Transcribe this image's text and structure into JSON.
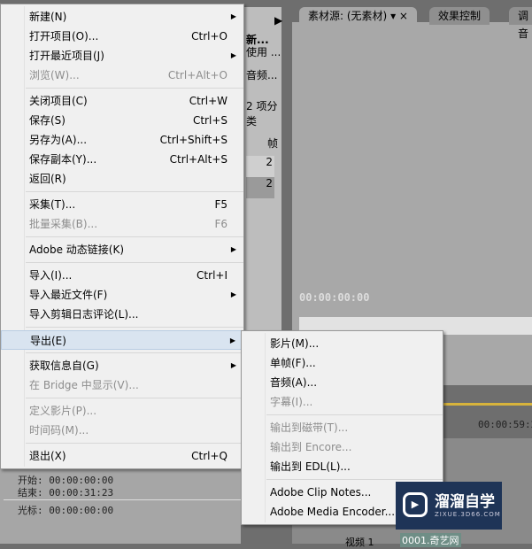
{
  "background": {
    "project_panel": {
      "line1": "新...",
      "line2": "使用 ...",
      "line3": "音频...",
      "count": "2 项分类",
      "col": "帧",
      "row1": "2",
      "row2": "2"
    },
    "source_tab": "素材源: (无素材)",
    "effects_tab": "效果控制",
    "mixer_tab": "调音",
    "source_timecode": "00:00:00:00",
    "timeline_timecode": "00:00:59:22",
    "info": {
      "start": "开始: 00:00:00:00",
      "end": "结束: 00:00:31:23",
      "cursor": "光标: 00:00:00:00"
    },
    "track_label": "视频 1",
    "clip_label": "0001.奇艺网"
  },
  "file_menu": [
    {
      "label": "新建(N)",
      "submenu": true
    },
    {
      "label": "打开项目(O)...",
      "shortcut": "Ctrl+O"
    },
    {
      "label": "打开最近项目(J)",
      "submenu": true
    },
    {
      "label": "浏览(W)...",
      "shortcut": "Ctrl+Alt+O",
      "disabled": true
    },
    {
      "sep": true
    },
    {
      "label": "关闭项目(C)",
      "shortcut": "Ctrl+W"
    },
    {
      "label": "保存(S)",
      "shortcut": "Ctrl+S"
    },
    {
      "label": "另存为(A)...",
      "shortcut": "Ctrl+Shift+S"
    },
    {
      "label": "保存副本(Y)...",
      "shortcut": "Ctrl+Alt+S"
    },
    {
      "label": "返回(R)"
    },
    {
      "sep": true
    },
    {
      "label": "采集(T)...",
      "shortcut": "F5"
    },
    {
      "label": "批量采集(B)...",
      "shortcut": "F6",
      "disabled": true
    },
    {
      "sep": true
    },
    {
      "label": "Adobe 动态链接(K)",
      "submenu": true
    },
    {
      "sep": true
    },
    {
      "label": "导入(I)...",
      "shortcut": "Ctrl+I"
    },
    {
      "label": "导入最近文件(F)",
      "submenu": true
    },
    {
      "label": "导入剪辑日志评论(L)..."
    },
    {
      "sep": true
    },
    {
      "label": "导出(E)",
      "submenu": true,
      "highlighted": true
    },
    {
      "sep": true
    },
    {
      "label": "获取信息自(G)",
      "submenu": true
    },
    {
      "label": "在 Bridge 中显示(V)...",
      "disabled": true
    },
    {
      "sep": true
    },
    {
      "label": "定义影片(P)...",
      "disabled": true
    },
    {
      "label": "时间码(M)...",
      "disabled": true
    },
    {
      "sep": true
    },
    {
      "label": "退出(X)",
      "shortcut": "Ctrl+Q"
    }
  ],
  "export_submenu": [
    {
      "label": "影片(M)..."
    },
    {
      "label": "单帧(F)..."
    },
    {
      "label": "音频(A)..."
    },
    {
      "label": "字幕(I)...",
      "disabled": true
    },
    {
      "sep": true
    },
    {
      "label": "输出到磁带(T)...",
      "disabled": true
    },
    {
      "label": "输出到 Encore...",
      "disabled": true
    },
    {
      "label": "输出到 EDL(L)..."
    },
    {
      "sep": true
    },
    {
      "label": "Adobe Clip Notes..."
    },
    {
      "label": "Adobe Media Encoder..."
    }
  ],
  "watermark": {
    "title": "溜溜自学",
    "url": "ZIXUE.3D66.COM"
  }
}
